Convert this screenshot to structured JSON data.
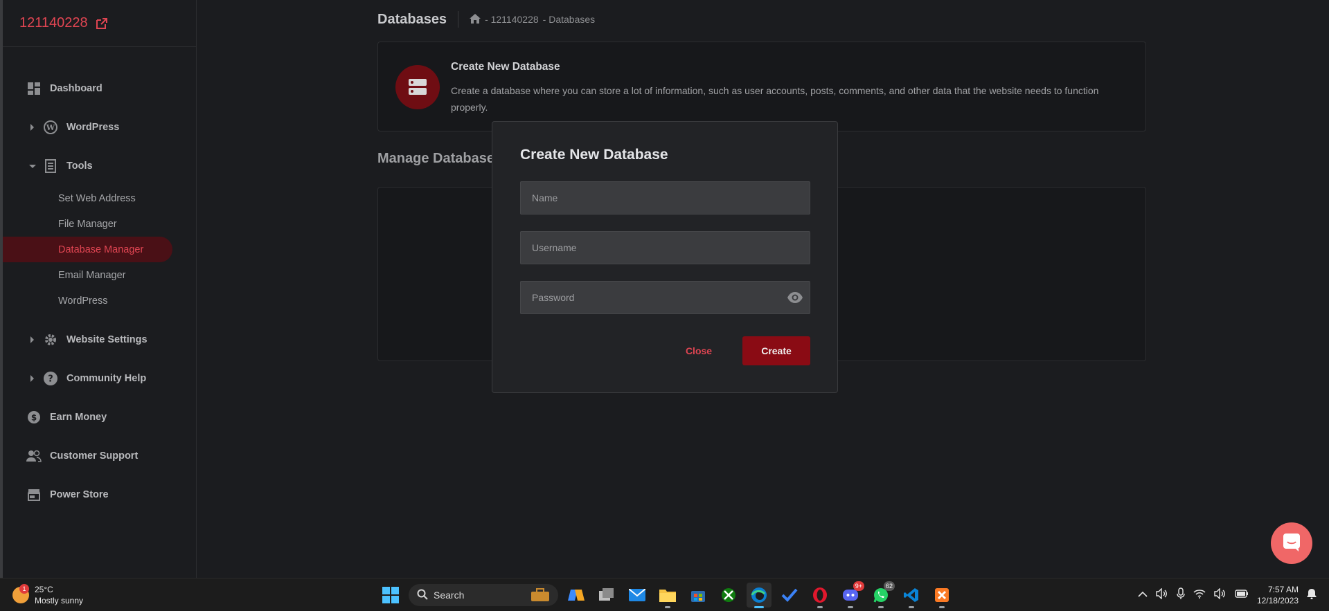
{
  "brand": {
    "site_id": "121140228"
  },
  "sidebar": {
    "items": [
      {
        "label": "Dashboard"
      },
      {
        "label": "WordPress"
      },
      {
        "label": "Tools"
      },
      {
        "label": "Website Settings"
      },
      {
        "label": "Community Help"
      },
      {
        "label": "Earn Money"
      },
      {
        "label": "Customer Support"
      },
      {
        "label": "Power Store"
      }
    ],
    "tools_sub": [
      {
        "label": "Set Web Address"
      },
      {
        "label": "File Manager"
      },
      {
        "label": "Database Manager"
      },
      {
        "label": "Email Manager"
      },
      {
        "label": "WordPress"
      }
    ]
  },
  "header": {
    "title": "Databases",
    "breadcrumb_site": "- 121140228",
    "breadcrumb_page": "- Databases"
  },
  "info_card": {
    "title": "Create New Database",
    "description": "Create a database where you can store a lot of information, such as user accounts, posts, comments, and other data that the website needs to function properly."
  },
  "manage": {
    "title": "Manage Databases"
  },
  "modal": {
    "title": "Create New Database",
    "name_placeholder": "Name",
    "username_placeholder": "Username",
    "password_placeholder": "Password",
    "close_label": "Close",
    "create_label": "Create"
  },
  "taskbar": {
    "temperature": "25°C",
    "weather": "Mostly sunny",
    "weather_badge": "1",
    "search_label": "Search",
    "discord_badge": "9+",
    "whatsapp_badge": "62",
    "time": "7:57 AM",
    "date": "12/18/2023"
  },
  "colors": {
    "accent": "#e04552",
    "create_button": "#8a0b14",
    "active_bg": "#4a1016",
    "chat_fab": "#f06767"
  }
}
